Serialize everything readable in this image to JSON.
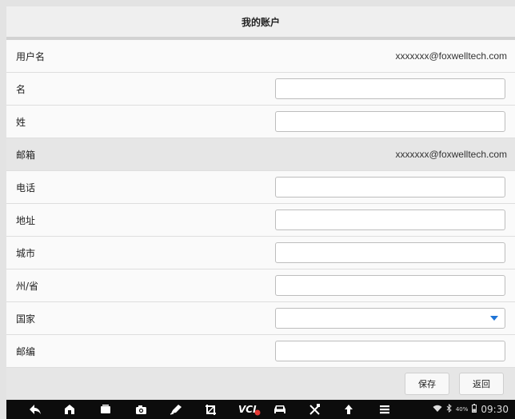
{
  "header": {
    "title": "我的账户"
  },
  "form": {
    "username": {
      "label": "用户名",
      "value": "xxxxxxx@foxwelltech.com"
    },
    "first_name": {
      "label": "名",
      "value": ""
    },
    "last_name": {
      "label": "姓",
      "value": ""
    },
    "email": {
      "label": "邮箱",
      "value": "xxxxxxx@foxwelltech.com"
    },
    "phone": {
      "label": "电话",
      "value": ""
    },
    "address": {
      "label": "地址",
      "value": ""
    },
    "city": {
      "label": "城市",
      "value": ""
    },
    "state": {
      "label": "州/省",
      "value": ""
    },
    "country": {
      "label": "国家",
      "selected": ""
    },
    "zip": {
      "label": "邮编",
      "value": ""
    }
  },
  "footer": {
    "save_label": "保存",
    "back_label": "返回"
  },
  "navbar": {
    "icons": [
      "back-icon",
      "home-icon",
      "recent-apps-icon",
      "camera-icon",
      "pen-icon",
      "crop-icon",
      "vci-icon",
      "car-icon",
      "tools-icon",
      "upload-icon",
      "menu-icon"
    ],
    "vci_label": "VCI",
    "battery_pct": "40%",
    "time": "09:30"
  },
  "colors": {
    "accent": "#1f74d6",
    "vci_status": "#e53935"
  }
}
